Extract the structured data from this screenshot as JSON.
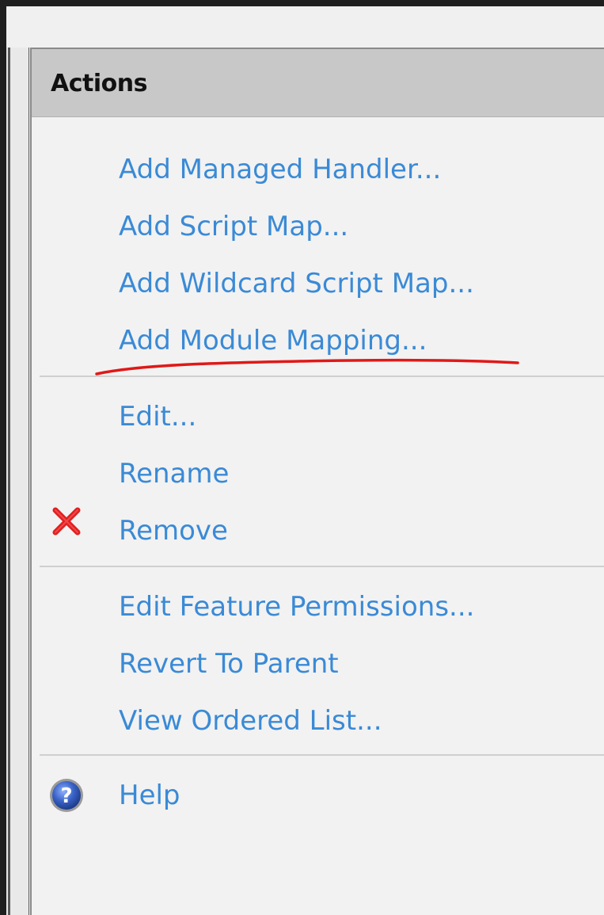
{
  "panel": {
    "title": "Actions"
  },
  "groups": {
    "add": [
      {
        "label": "Add Managed Handler..."
      },
      {
        "label": "Add Script Map..."
      },
      {
        "label": "Add Wildcard Script Map..."
      },
      {
        "label": "Add Module Mapping..."
      }
    ],
    "edit": [
      {
        "label": "Edit..."
      },
      {
        "label": "Rename"
      },
      {
        "label": "Remove"
      }
    ],
    "feature": [
      {
        "label": "Edit Feature Permissions..."
      },
      {
        "label": "Revert To Parent"
      },
      {
        "label": "View Ordered List..."
      }
    ],
    "help": [
      {
        "label": "Help"
      }
    ]
  },
  "icons": {
    "remove": "x-icon",
    "help": "help-icon"
  },
  "colors": {
    "link": "#3a8ad6",
    "remove_icon": "#e02020",
    "help_icon": "#2f57b8",
    "annotation": "#e01818",
    "header_bg": "#c8c8c8"
  }
}
